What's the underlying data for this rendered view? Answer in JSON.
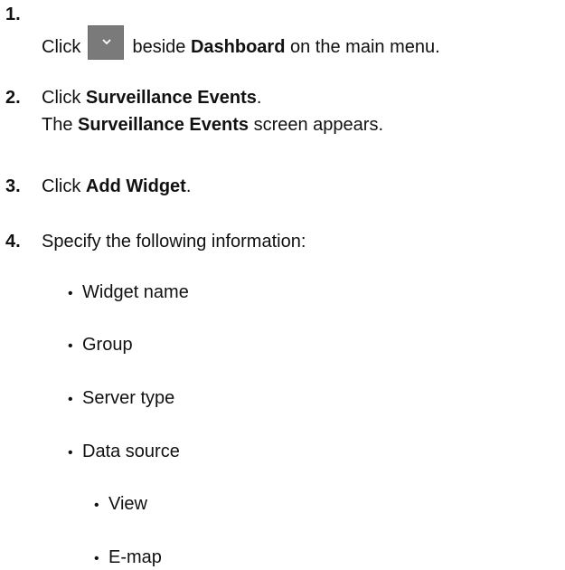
{
  "steps": [
    {
      "number": "1.",
      "lines": [
        {
          "pre": "Click",
          "icon": "chevron-down-icon",
          "post": "beside",
          "bold": "Dashboard",
          "tail": "on the main menu."
        }
      ]
    },
    {
      "number": "2.",
      "line1_pre": "Click",
      "line1_bold": "Surveillance Events",
      "line1_tail": ".",
      "line2_pre": "The",
      "line2_bold": "Surveillance Events",
      "line2_tail": "screen appears."
    },
    {
      "number": "3.",
      "pre": "Click",
      "bold": "Add Widget",
      "tail": "."
    },
    {
      "number": "4.",
      "text": "Specify the following information:",
      "bullets": [
        "Widget name",
        "Group",
        "Server type",
        "Data source"
      ],
      "sub_bullets": [
        "View",
        "E-map"
      ],
      "bullet_glyph": "•"
    }
  ],
  "colors": {
    "button_bg": "#7a7a7a",
    "text": "#111111"
  }
}
